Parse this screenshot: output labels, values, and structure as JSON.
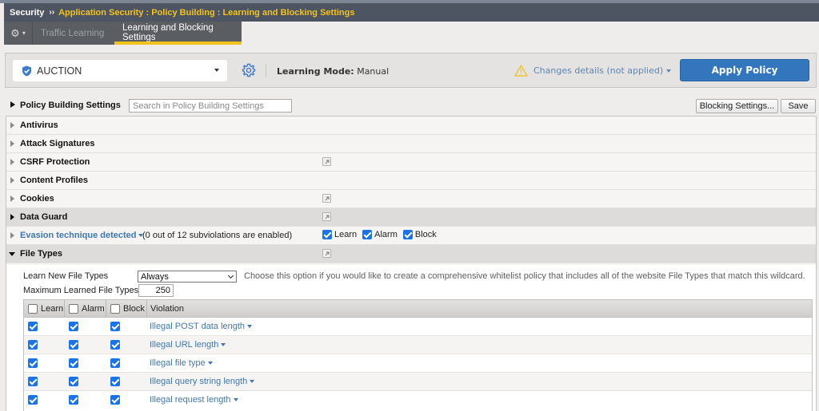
{
  "header": {
    "section": "Security",
    "separator": "››",
    "path": "Application Security : Policy Building : Learning and Blocking Settings"
  },
  "tabs": {
    "menu_icon": "gear-icon",
    "items": [
      {
        "label": "Traffic Learning",
        "active": false
      },
      {
        "label": "Learning and Blocking Settings",
        "active": true
      }
    ]
  },
  "policy_bar": {
    "policy_name": "AUCTION",
    "policy_icon": "shield-check-icon",
    "settings_icon": "gear-icon",
    "learning_mode_label": "Learning Mode:",
    "learning_mode_value": "Manual",
    "changes_label": "Changes details (not applied)",
    "apply_button": "Apply Policy",
    "accent_color": "#3376bd",
    "warning_color": "#f3c432"
  },
  "policy_building": {
    "title": "Policy Building Settings",
    "search_placeholder": "Search in Policy Building Settings",
    "blocking_settings_button": "Blocking Settings...",
    "save_button": "Save"
  },
  "sections": [
    {
      "label": "Antivirus",
      "expanded": false,
      "external_link": false
    },
    {
      "label": "Attack Signatures",
      "expanded": false,
      "external_link": false
    },
    {
      "label": "CSRF Protection",
      "expanded": false,
      "external_link": true
    },
    {
      "label": "Content Profiles",
      "expanded": false,
      "external_link": false
    },
    {
      "label": "Cookies",
      "expanded": false,
      "external_link": true
    },
    {
      "label": "Data Guard",
      "expanded": false,
      "external_link": true
    },
    {
      "label": "Evasion technique detected",
      "note": "(0 out of 12 subviolations are enabled)",
      "learn": true,
      "alarm": true,
      "block": true,
      "learn_label": "Learn",
      "alarm_label": "Alarm",
      "block_label": "Block"
    },
    {
      "label": "File Types",
      "expanded": true,
      "external_link": true
    }
  ],
  "file_types": {
    "learn_new_label": "Learn New File Types",
    "learn_new_value": "Always",
    "learn_new_hint": "Choose this option if you would like to create a comprehensive whitelist policy that includes all of the website File Types that match this wildcard.",
    "max_learned_label": "Maximum Learned File Types",
    "max_learned_value": "250",
    "table": {
      "columns": [
        "Learn",
        "Alarm",
        "Block",
        "Violation"
      ],
      "rows": [
        {
          "violation": "Illegal POST data length",
          "learn": true,
          "alarm": true,
          "block": true
        },
        {
          "violation": "Illegal URL length",
          "learn": true,
          "alarm": true,
          "block": true
        },
        {
          "violation": "Illegal file type",
          "learn": true,
          "alarm": true,
          "block": true
        },
        {
          "violation": "Illegal query string length",
          "learn": true,
          "alarm": true,
          "block": true
        },
        {
          "violation": "Illegal request length",
          "learn": true,
          "alarm": true,
          "block": true
        }
      ]
    }
  }
}
